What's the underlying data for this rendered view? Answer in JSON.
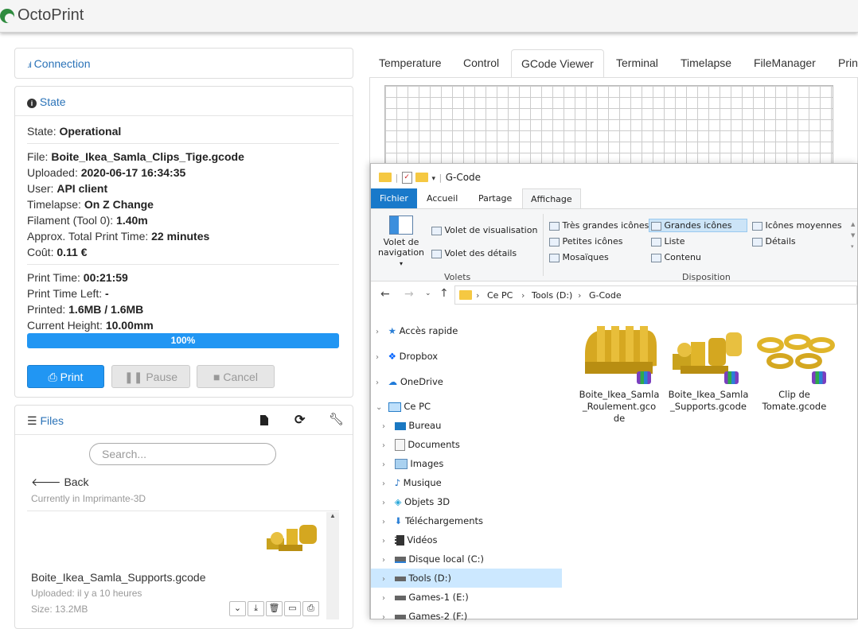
{
  "app": {
    "title": "OctoPrint"
  },
  "connection": {
    "label": "Connection"
  },
  "state": {
    "label": "State",
    "status_label": "State: ",
    "status_value": "Operational",
    "file_label": "File: ",
    "file_value": "Boite_Ikea_Samla_Clips_Tige.gcode",
    "uploaded_label": "Uploaded: ",
    "uploaded_value": "2020-06-17 16:34:35",
    "user_label": "User: ",
    "user_value": "API client",
    "timelapse_label": "Timelapse: ",
    "timelapse_value": "On Z Change",
    "filament_label": "Filament (Tool 0): ",
    "filament_value": "1.40m",
    "approx_label": "Approx. Total Print Time: ",
    "approx_value": "22 minutes",
    "cost_label": "Coût: ",
    "cost_value": "0.11 €",
    "print_time_label": "Print Time: ",
    "print_time_value": "00:21:59",
    "time_left_label": "Print Time Left: ",
    "time_left_value": "-",
    "printed_label": "Printed: ",
    "printed_value": "1.6MB / 1.6MB",
    "height_label": "Current Height: ",
    "height_value": "10.00mm",
    "progress_text": "100%",
    "progress_fraction": 1.0,
    "print_button": "Print",
    "pause_button": "Pause",
    "cancel_button": "Cancel"
  },
  "files": {
    "label": "Files",
    "search_placeholder": "Search...",
    "back_label": "Back",
    "location": "Currently in Imprimante-3D",
    "item_name": "Boite_Ikea_Samla_Supports.gcode",
    "item_uploaded": "Uploaded: il y a 10 heures",
    "item_size": "Size: 13.2MB"
  },
  "tabs": [
    "Temperature",
    "Control",
    "GCode Viewer",
    "Terminal",
    "Timelapse",
    "FileManager",
    "Prin"
  ],
  "active_tab": "GCode Viewer",
  "explorer": {
    "title": "G-Code",
    "ribbon_tabs": [
      "Fichier",
      "Accueil",
      "Partage",
      "Affichage"
    ],
    "pane_nav_label_1": "Volet de",
    "pane_nav_label_2": "navigation",
    "preview_pane": "Volet de visualisation",
    "details_pane": "Volet des détails",
    "volets_group": "Volets",
    "layout_items": [
      "Très grandes icônes",
      "Grandes icônes",
      "Icônes moyennes",
      "Petites icônes",
      "Liste",
      "Détails",
      "Mosaïques",
      "Contenu"
    ],
    "layout_group": "Disposition",
    "breadcrumb": [
      "Ce PC",
      "Tools (D:)",
      "G-Code"
    ],
    "tree": [
      {
        "label": "Accès rapide",
        "icon": "star-icon",
        "level": 0
      },
      {
        "label": "Dropbox",
        "icon": "dropbox-icon",
        "level": 0
      },
      {
        "label": "OneDrive",
        "icon": "cloud-icon",
        "level": 0
      },
      {
        "label": "Ce PC",
        "icon": "pc-icon",
        "level": 0
      },
      {
        "label": "Bureau",
        "icon": "desktop-icon",
        "level": 1
      },
      {
        "label": "Documents",
        "icon": "document-icon",
        "level": 1
      },
      {
        "label": "Images",
        "icon": "image-icon",
        "level": 1
      },
      {
        "label": "Musique",
        "icon": "music-icon",
        "level": 1
      },
      {
        "label": "Objets 3D",
        "icon": "cube-icon",
        "level": 1
      },
      {
        "label": "Téléchargements",
        "icon": "download-icon",
        "level": 1
      },
      {
        "label": "Vidéos",
        "icon": "video-icon",
        "level": 1
      },
      {
        "label": "Disque local (C:)",
        "icon": "drive-icon",
        "level": 1
      },
      {
        "label": "Tools (D:)",
        "icon": "drive-icon",
        "level": 1
      },
      {
        "label": "Games-1 (E:)",
        "icon": "drive-icon",
        "level": 1
      },
      {
        "label": "Games-2 (F:)",
        "icon": "drive-icon",
        "level": 1
      }
    ],
    "files": [
      {
        "name_1": "Boite_Ikea_Samla",
        "name_2": "_Roulement.gco",
        "name_3": "de"
      },
      {
        "name_1": "Boite_Ikea_Samla",
        "name_2": "_Supports.gcode",
        "name_3": ""
      },
      {
        "name_1": "Clip de",
        "name_2": "Tomate.gcode",
        "name_3": ""
      }
    ]
  }
}
